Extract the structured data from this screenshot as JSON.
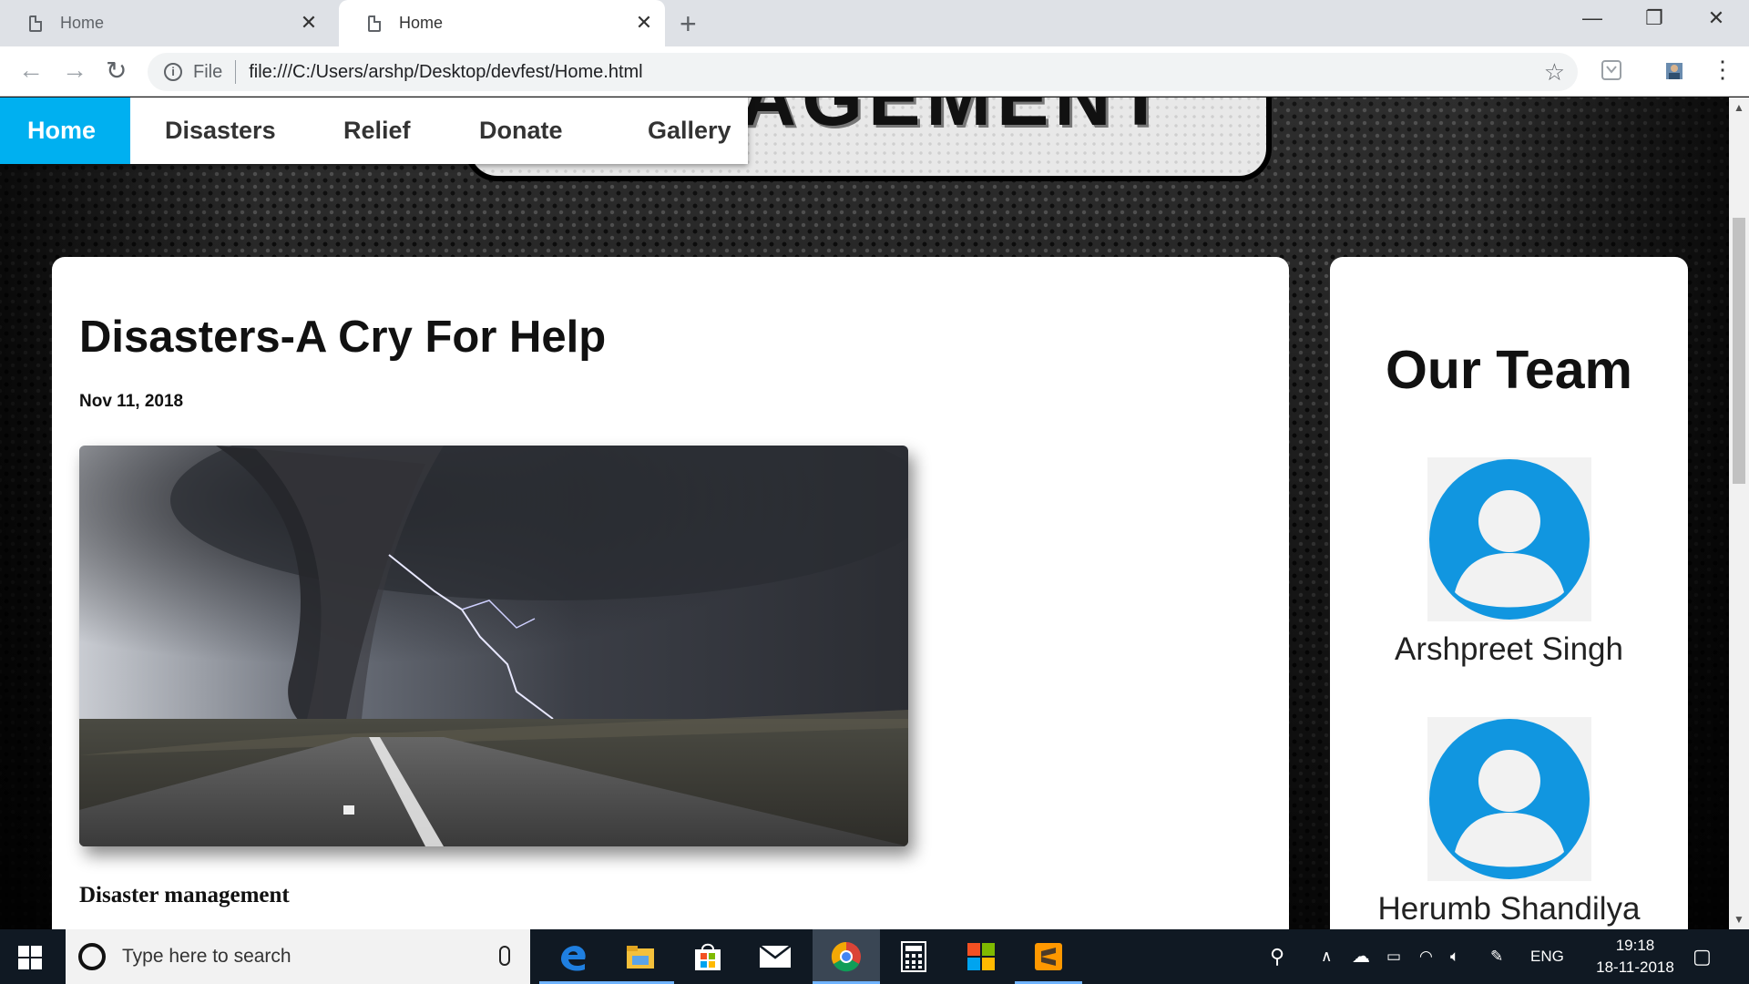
{
  "browser": {
    "tabs": [
      {
        "title": "Home"
      },
      {
        "title": "Home"
      }
    ],
    "address": {
      "scheme_label": "File",
      "url": "file:///C:/Users/arshp/Desktop/devfest/Home.html"
    }
  },
  "site": {
    "banner_text": "AGEMENT",
    "nav": [
      {
        "label": "Home"
      },
      {
        "label": "Disasters"
      },
      {
        "label": "Relief"
      },
      {
        "label": "Donate"
      },
      {
        "label": "Gallery"
      }
    ],
    "post": {
      "title": "Disasters-A Cry For Help",
      "date": "Nov 11, 2018",
      "subtitle": "Disaster management"
    },
    "team": {
      "title": "Our Team",
      "members": [
        {
          "name": "Arshpreet Singh"
        },
        {
          "name": "Herumb Shandilya"
        }
      ]
    },
    "colors": {
      "nav_active": "#00b0f0",
      "avatar": "#1196e0"
    }
  },
  "taskbar": {
    "search_placeholder": "Type here to search",
    "language": "ENG",
    "time": "19:18",
    "date": "18-11-2018",
    "apps": [
      "edge-icon",
      "file-explorer-icon",
      "store-icon",
      "mail-icon",
      "chrome-icon",
      "calculator-icon",
      "office-icon",
      "sublime-text-icon"
    ]
  }
}
